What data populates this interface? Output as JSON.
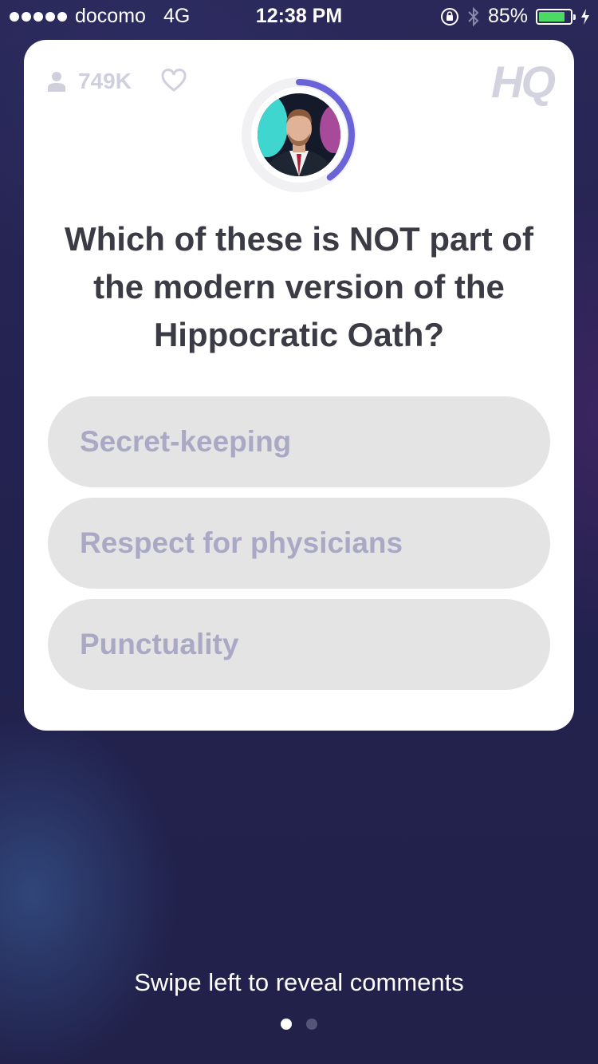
{
  "status_bar": {
    "carrier": "docomo",
    "network": "4G",
    "time": "12:38 PM",
    "battery_percent": "85%",
    "battery_level": 0.85
  },
  "card": {
    "viewer_count": "749K",
    "logo": "HQ",
    "timer_progress": 0.4,
    "question": "Which of these is NOT part of the modern version of the Hippocratic Oath?",
    "answers": [
      "Secret-keeping",
      "Respect for physicians",
      "Punctuality"
    ]
  },
  "footer": {
    "hint": "Swipe left to reveal comments",
    "page_count": 2,
    "current_page": 1
  },
  "colors": {
    "background": "#22224a",
    "timer_accent": "#6b63d8",
    "answer_bg": "#e4e4e4",
    "answer_text": "#a9a9c6",
    "battery": "#4cd964"
  },
  "icons": [
    "person-icon",
    "heart-icon",
    "lock-rotation-icon",
    "bluetooth-icon",
    "battery-icon",
    "charging-icon"
  ]
}
